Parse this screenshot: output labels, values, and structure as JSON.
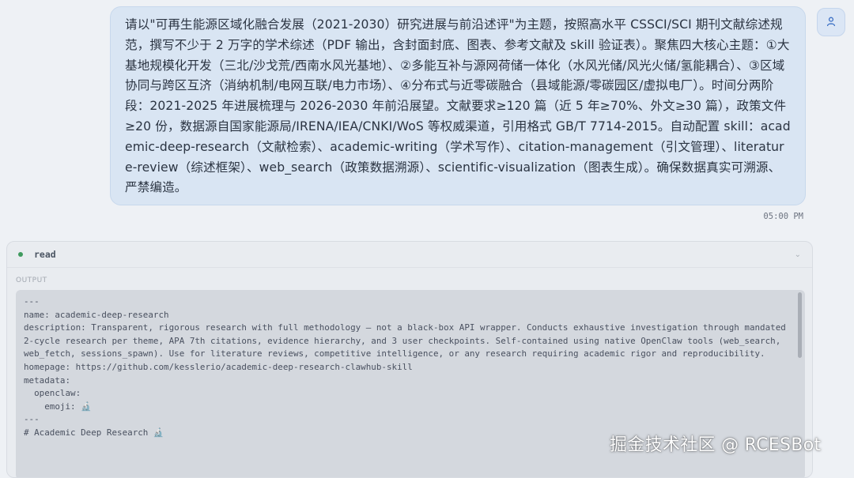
{
  "user_message": {
    "text": "请以\"可再生能源区域化融合发展（2021-2030）研究进展与前沿述评\"为主题，按照高水平 CSSCI/SCI 期刊文献综述规范，撰写不少于 2 万字的学术综述（PDF 输出，含封面封底、图表、参考文献及 skill 验证表）。聚焦四大核心主题：①大基地规模化开发（三北/沙戈荒/西南水风光基地）、②多能互补与源网荷储一体化（水风光储/风光火储/氢能耦合）、③区域协同与跨区互济（消纳机制/电网互联/电力市场）、④分布式与近零碳融合（县域能源/零碳园区/虚拟电厂）。时间分两阶段：2021-2025 年进展梳理与 2026-2030 年前沿展望。文献要求≥120 篇（近 5 年≥70%、外文≥30 篇），政策文件≥20 份，数据源自国家能源局/IRENA/IEA/CNKI/WoS 等权威渠道，引用格式 GB/T 7714-2015。自动配置 skill：academic-deep-research（文献检索）、academic-writing（学术写作）、citation-management（引文管理）、literature-review（综述框架）、web_search（政策数据溯源）、scientific-visualization（图表生成）。确保数据真实可溯源、严禁编造。",
    "time": "05:00 PM",
    "avatar_icon": "user-icon"
  },
  "tool_call": {
    "name": "read",
    "status_color": "#3f9a5e",
    "output_label": "OUTPUT",
    "output_lines": [
      "---",
      "name: academic-deep-research",
      "description: Transparent, rigorous research with full methodology — not a black-box API wrapper. Conducts exhaustive investigation through mandated 2-cycle research per theme, APA 7th citations, evidence hierarchy, and 3 user checkpoints. Self-contained using native OpenClaw tools (web_search, web_fetch, sessions_spawn). Use for literature reviews, competitive intelligence, or any research requiring academic rigor and reproducibility.",
      "homepage: https://github.com/kesslerio/academic-deep-research-clawhub-skill",
      "metadata:",
      "  openclaw:",
      "    emoji: 🔬",
      "---",
      "",
      "# Academic Deep Research 🔬"
    ]
  },
  "watermark": "掘金技术社区 @ RCESBot"
}
